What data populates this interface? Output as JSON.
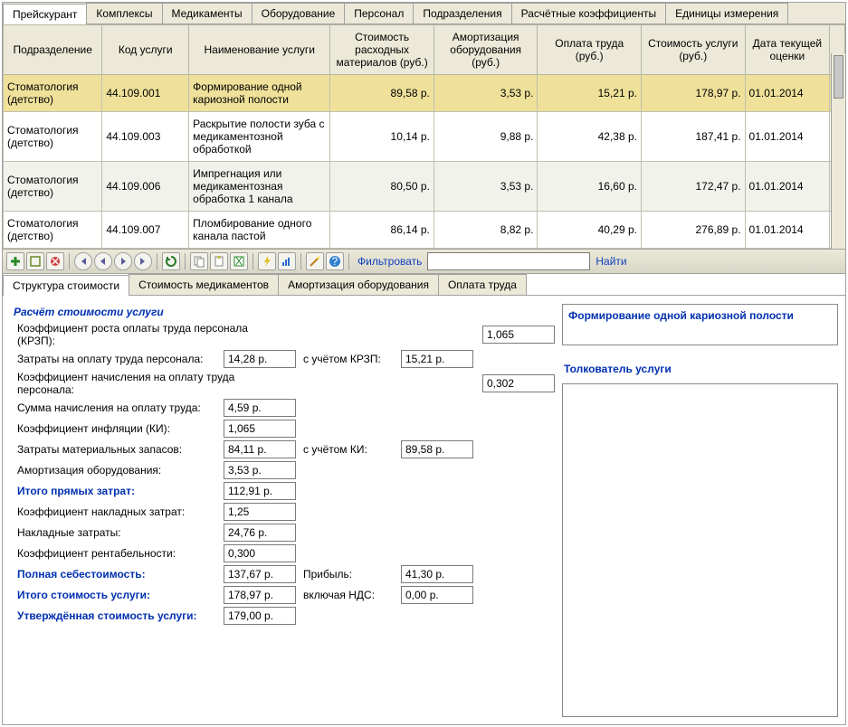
{
  "tabs": [
    "Прейскурант",
    "Комплексы",
    "Медикаменты",
    "Оборудование",
    "Персонал",
    "Подразделения",
    "Расчётные коэффициенты",
    "Единицы измерения"
  ],
  "headers": [
    "Подразделение",
    "Код услуги",
    "Наименование услуги",
    "Стоимость расходных материалов (руб.)",
    "Амортизация оборудования (руб.)",
    "Оплата труда (руб.)",
    "Стоимость услуги (руб.)",
    "Дата текущей оценки"
  ],
  "rows": [
    {
      "dep": "Стоматология (детство)",
      "code": "44.109.001",
      "name": "Формирование одной кариозной полости",
      "mat": "89,58 р.",
      "amort": "3,53 р.",
      "labor": "15,21 р.",
      "cost": "178,97 р.",
      "date": "01.01.2014",
      "sel": true
    },
    {
      "dep": "Стоматология (детство)",
      "code": "44.109.003",
      "name": "Раскрытие полости зуба с медикаментозной обработкой",
      "mat": "10,14 р.",
      "amort": "9,88 р.",
      "labor": "42,38 р.",
      "cost": "187,41 р.",
      "date": "01.01.2014"
    },
    {
      "dep": "Стоматология (детство)",
      "code": "44.109.006",
      "name": "Импрегнация или медикаментозная обработка 1 канала",
      "mat": "80,50 р.",
      "amort": "3,53 р.",
      "labor": "16,60 р.",
      "cost": "172,47 р.",
      "date": "01.01.2014",
      "alt": true
    },
    {
      "dep": "Стоматология (детство)",
      "code": "44.109.007",
      "name": "Пломбирование одного канала пастой",
      "mat": "86,14 р.",
      "amort": "8,82 р.",
      "labor": "40,29 р.",
      "cost": "276,89 р.",
      "date": "01.01.2014"
    }
  ],
  "toolbar": {
    "filter": "Фильтровать",
    "find": "Найти"
  },
  "subtabs": [
    "Структура стоимости",
    "Стоимость медикаментов",
    "Амортизация оборудования",
    "Оплата труда"
  ],
  "detail": {
    "title": "Расчёт стоимости услуги",
    "krzp_label": "Коэффициент роста оплаты труда персонала (КРЗП):",
    "krzp": "1,065",
    "labor_costs_label": "Затраты на оплату труда персонала:",
    "labor_costs": "14,28 р.",
    "with_krzp": "с учётом КРЗП:",
    "labor_krzp": "15,21 р.",
    "accr_coef_label": "Коэффициент начисления на оплату труда персонала:",
    "accr_coef": "0,302",
    "accr_sum_label": "Сумма начисления на оплату труда:",
    "accr_sum": "4,59 р.",
    "infl_label": "Коэффициент инфляции (КИ):",
    "infl": "1,065",
    "mat_label": "Затраты материальных запасов:",
    "mat": "84,11 р.",
    "with_ki": "с учётом КИ:",
    "mat_ki": "89,58 р.",
    "amort_label": "Амортизация оборудования:",
    "amort": "3,53 р.",
    "direct_total_label": "Итого прямых затрат:",
    "direct_total": "112,91 р.",
    "overhead_coef_label": "Коэффициент накладных затрат:",
    "overhead_coef": "1,25",
    "overhead_label": "Накладные затраты:",
    "overhead": "24,76 р.",
    "profit_coef_label": "Коэффициент рентабельности:",
    "profit_coef": "0,300",
    "full_cost_label": "Полная себестоимость:",
    "full_cost": "137,67 р.",
    "profit_label": "Прибыль:",
    "profit": "41,30 р.",
    "total_cost_label": "Итого стоимость услуги:",
    "total_cost": "178,97 р.",
    "vat_label": "включая НДС:",
    "vat": "0,00 р.",
    "approved_label": "Утверждённая стоимость услуги:",
    "approved": "179,00 р.",
    "service_name": "Формирование одной кариозной полости",
    "interpreter": "Толкователь услуги"
  }
}
